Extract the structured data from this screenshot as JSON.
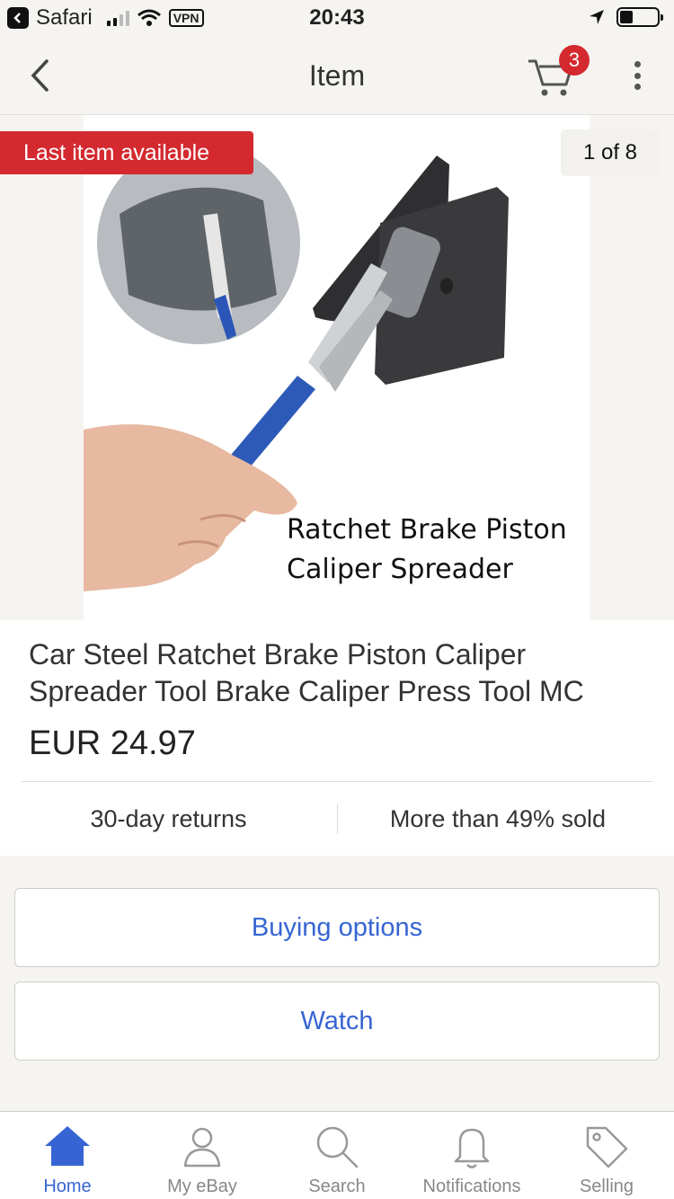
{
  "status_bar": {
    "app_name": "Safari",
    "vpn": "VPN",
    "time": "20:43"
  },
  "nav": {
    "title": "Item",
    "cart_count": "3"
  },
  "gallery": {
    "badge": "Last item available",
    "counter": "1 of 8",
    "image_caption_line1": "Ratchet Brake Piston",
    "image_caption_line2": "Caliper Spreader"
  },
  "listing": {
    "title": "Car Steel Ratchet Brake Piston Caliper Spreader Tool Brake Caliper Press Tool MC",
    "price": "EUR 24.97",
    "returns": "30-day returns",
    "sold": "More than 49% sold"
  },
  "actions": {
    "buying_options": "Buying options",
    "watch": "Watch"
  },
  "tabs": [
    {
      "label": "Home",
      "icon": "home-icon"
    },
    {
      "label": "My eBay",
      "icon": "person-icon"
    },
    {
      "label": "Search",
      "icon": "search-icon"
    },
    {
      "label": "Notifications",
      "icon": "bell-icon"
    },
    {
      "label": "Selling",
      "icon": "tag-icon"
    }
  ],
  "colors": {
    "accent": "#3665d3",
    "badge": "#d3292f",
    "background": "#f6f4f1"
  }
}
